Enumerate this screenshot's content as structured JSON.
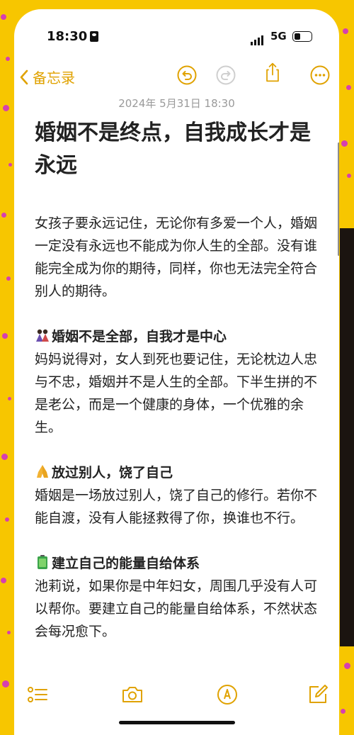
{
  "status_bar": {
    "time": "18:30",
    "network": "5G"
  },
  "nav": {
    "back_label": "备忘录"
  },
  "note": {
    "timestamp": "2024年 5月31日 18:30",
    "title": "婚姻不是终点，自我成长才是永远",
    "intro": "女孩子要永远记住，无论你有多爱一个人，婚姻一定没有永远也不能成为你人生的全部。没有谁能完全成为你的期待，同样，你也无法完全符合别人的期待。",
    "sections": [
      {
        "heading": "婚姻不是全部，自我才是中心",
        "icon": "couple-emoji",
        "text": "妈妈说得对，女人到死也要记住，无论枕边人忠与不忠，婚姻并不是人生的全部。下半生拼的不是老公，而是一个健康的身体，一个优雅的余生。"
      },
      {
        "heading": "放过别人，饶了自己",
        "icon": "praying-hands-emoji",
        "text": "婚姻是一场放过别人，饶了自己的修行。若你不能自渡，没有人能拯救得了你，换谁也不行。"
      },
      {
        "heading": "建立自己的能量自给体系",
        "icon": "battery-emoji",
        "text": "池莉说，如果你是中年妇女，周围几乎没有人可以帮你。要建立自己的能量自给体系，不然状态会每况愈下。"
      }
    ]
  },
  "colors": {
    "accent": "#e0a200",
    "background": "#f7c600",
    "dots": "#d63fb0"
  }
}
